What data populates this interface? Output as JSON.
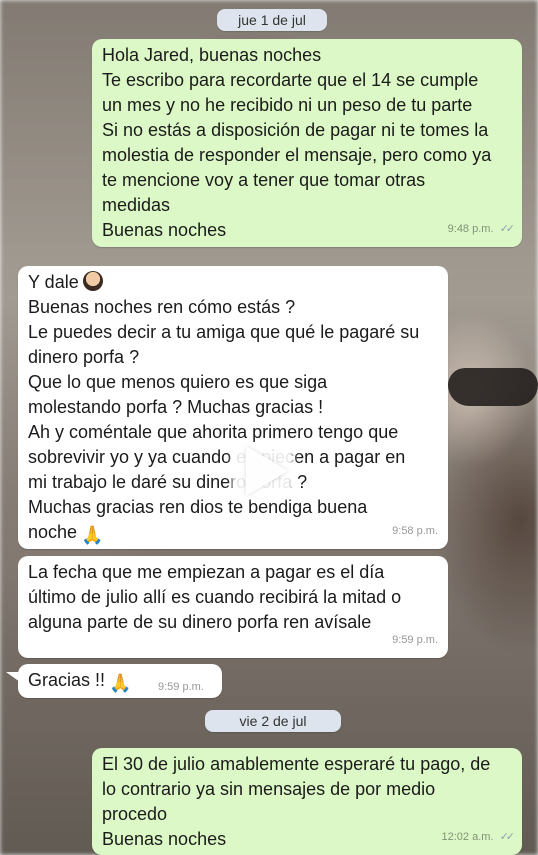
{
  "dates": {
    "first": "jue 1 de jul",
    "second": "vie 2 de jul"
  },
  "messages": [
    {
      "direction": "outgoing",
      "lines": [
        "Hola Jared, buenas noches",
        "Te escribo para recordarte que el 14 se cumple",
        "un mes y no he recibido ni un peso de tu parte",
        "Si no estás a disposición de pagar ni te tomes la",
        "molestia de responder el mensaje, pero como ya",
        "te mencione voy a tener que tomar otras",
        "medidas",
        "Buenas noches"
      ],
      "time": "9:48 p.m.",
      "status_icon": "double-check-icon"
    },
    {
      "direction": "incoming",
      "lines": [
        "Y dale",
        "Buenas noches ren cómo estás ?",
        "Le puedes decir a tu amiga que qué le pagaré su",
        "dinero porfa ?",
        "Que lo que menos quiero es que siga",
        "molestando porfa ? Muchas gracias !",
        "Ah y coméntale que ahorita primero tengo que",
        "sobrevivir yo y ya cuando empiecen a pagar en",
        "mi trabajo le daré su dinero porfa ?",
        "Muchas gracias ren dios te bendiga buena",
        "noche"
      ],
      "time": "9:58 p.m."
    },
    {
      "direction": "incoming",
      "lines": [
        "La fecha que me empiezan a pagar es el día",
        "último de julio allí es cuando recibirá la mitad o",
        "alguna parte de su dinero porfa ren avísale"
      ],
      "time": "9:59 p.m."
    },
    {
      "direction": "incoming",
      "lines": [
        "Gracias !!"
      ],
      "time": "9:59 p.m."
    },
    {
      "direction": "outgoing",
      "lines": [
        "El 30 de julio amablemente esperaré tu pago, de",
        "lo contrario ya sin mensajes de por medio",
        "procedo",
        "Buenas noches"
      ],
      "time": "12:02 a.m.",
      "status_icon": "double-check-icon"
    }
  ],
  "icons": {
    "man_emoji": "man-emoji-icon",
    "pray_emoji": "folded-hands-emoji-icon",
    "video_play": "play-icon"
  },
  "colors": {
    "outgoing_bubble": "#dcf8c6",
    "incoming_bubble": "#ffffff",
    "date_pill": "#dde4ee"
  }
}
